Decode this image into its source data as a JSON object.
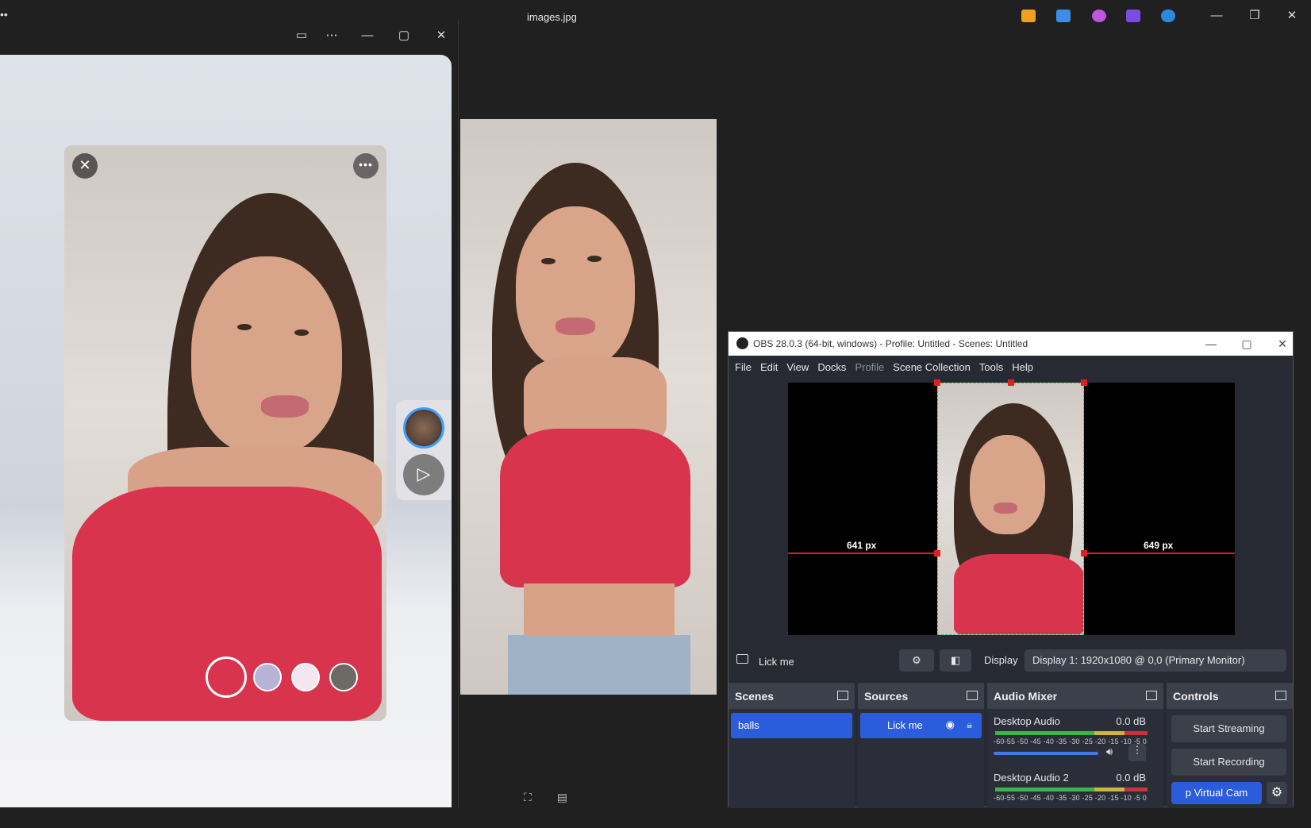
{
  "viewer": {
    "title": "images.jpg",
    "window_controls": {
      "minimize": "—",
      "maximize": "❐",
      "close": "✕"
    },
    "taskbar_icon_colors": [
      "#f0a020",
      "#3a8ee6",
      "#c056e0",
      "#7a4ce0",
      "#2b8ae0"
    ],
    "bottom_icons": [
      "⛶",
      "▤"
    ]
  },
  "snap": {
    "titlebar_icons": {
      "camera": "▭",
      "more": "⋯",
      "minimize": "—",
      "maximize": "▢",
      "close": "✕"
    },
    "close_glyph": "✕",
    "more_glyph": "•••",
    "play_glyph": "▷",
    "lens_colors": [
      "#b7b3d6",
      "#f4e6ee",
      "#6d6a66"
    ]
  },
  "obs": {
    "title": "OBS 28.0.3 (64-bit, windows) - Profile: Untitled - Scenes: Untitled",
    "menu": [
      "File",
      "Edit",
      "View",
      "Docks",
      "Profile",
      "Scene Collection",
      "Tools",
      "Help"
    ],
    "preview": {
      "left_distance": "641 px",
      "right_distance": "649 px"
    },
    "source_bar": {
      "source_name": "Lick me",
      "gear": "⚙",
      "filter": "◧",
      "display_label": "Display",
      "display_value": "Display 1: 1920x1080 @ 0,0 (Primary Monitor)"
    },
    "scenes": {
      "title": "Scenes",
      "items": [
        "balls"
      ]
    },
    "sources": {
      "title": "Sources",
      "items": [
        "Lick me"
      ]
    },
    "mixer": {
      "title": "Audio Mixer",
      "channels": [
        {
          "name": "Desktop Audio",
          "level": "0.0 dB",
          "ticks": "-60-55 -50 -45 -40 -35 -30 -25 -20 -15 -10 -5  0"
        },
        {
          "name": "Desktop Audio 2",
          "level": "0.0 dB",
          "ticks": "-60-55 -50 -45 -40 -35 -30 -25 -20 -15 -10 -5  0"
        }
      ]
    },
    "controls": {
      "title": "Controls",
      "start_streaming": "Start Streaming",
      "start_recording": "Start Recording",
      "virtual_cam": "p Virtual Cam"
    }
  }
}
